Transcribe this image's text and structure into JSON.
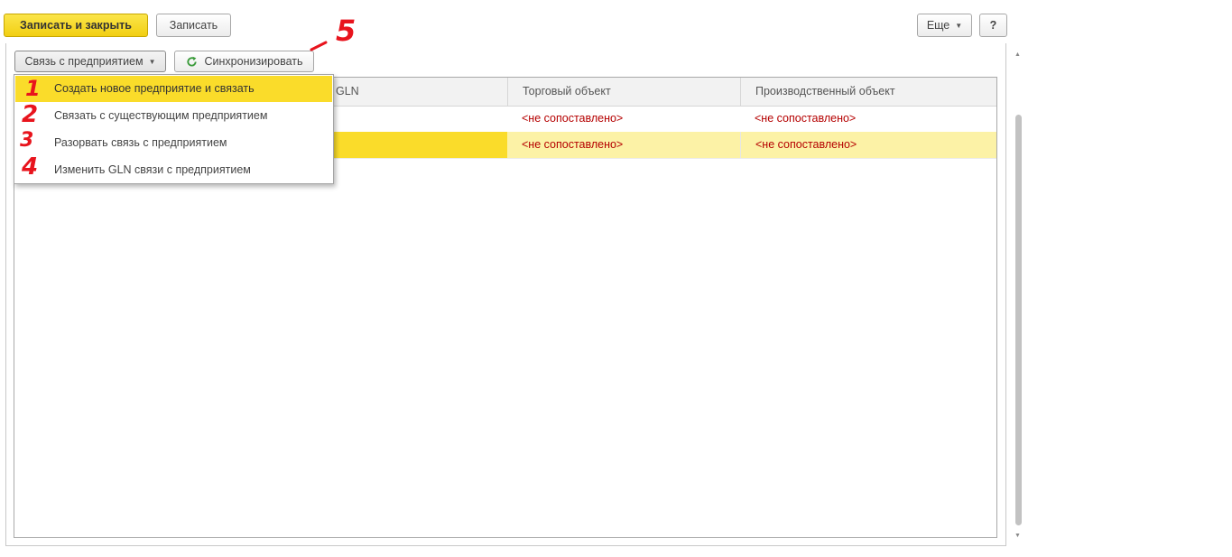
{
  "toolbar": {
    "save_close_label": "Записать и закрыть",
    "save_label": "Записать",
    "more_label": "Еще",
    "help_label": "?"
  },
  "actions": {
    "link_enterprise_label": "Связь с предприятием",
    "sync_label": "Синхронизировать"
  },
  "table": {
    "columns": [
      "GLN",
      "Торговый объект",
      "Производственный объект"
    ],
    "rows": [
      {
        "trade_object": "<не сопоставлено>",
        "production_object": "<не сопоставлено>",
        "selected": false
      },
      {
        "trade_object": "<не сопоставлено>",
        "production_object": "<не сопоставлено>",
        "selected": true
      }
    ]
  },
  "dropdown_menu": {
    "items": [
      {
        "label": "Создать новое предприятие и связать",
        "active": true
      },
      {
        "label": "Связать с существующим предприятием",
        "active": false
      },
      {
        "label": "Разорвать связь с предприятием",
        "active": false
      },
      {
        "label": "Изменить GLN связи с предприятием",
        "active": false
      }
    ]
  },
  "annotations": {
    "n1": "1",
    "n2": "2",
    "n3": "3",
    "n4": "4",
    "n5": "5"
  },
  "colors": {
    "accent_yellow": "#fadc2a",
    "selected_row": "#fcf2a6",
    "unmatched_text": "#b50000",
    "annotation_red": "#e8141d",
    "sync_icon_green": "#3a9b3a"
  }
}
